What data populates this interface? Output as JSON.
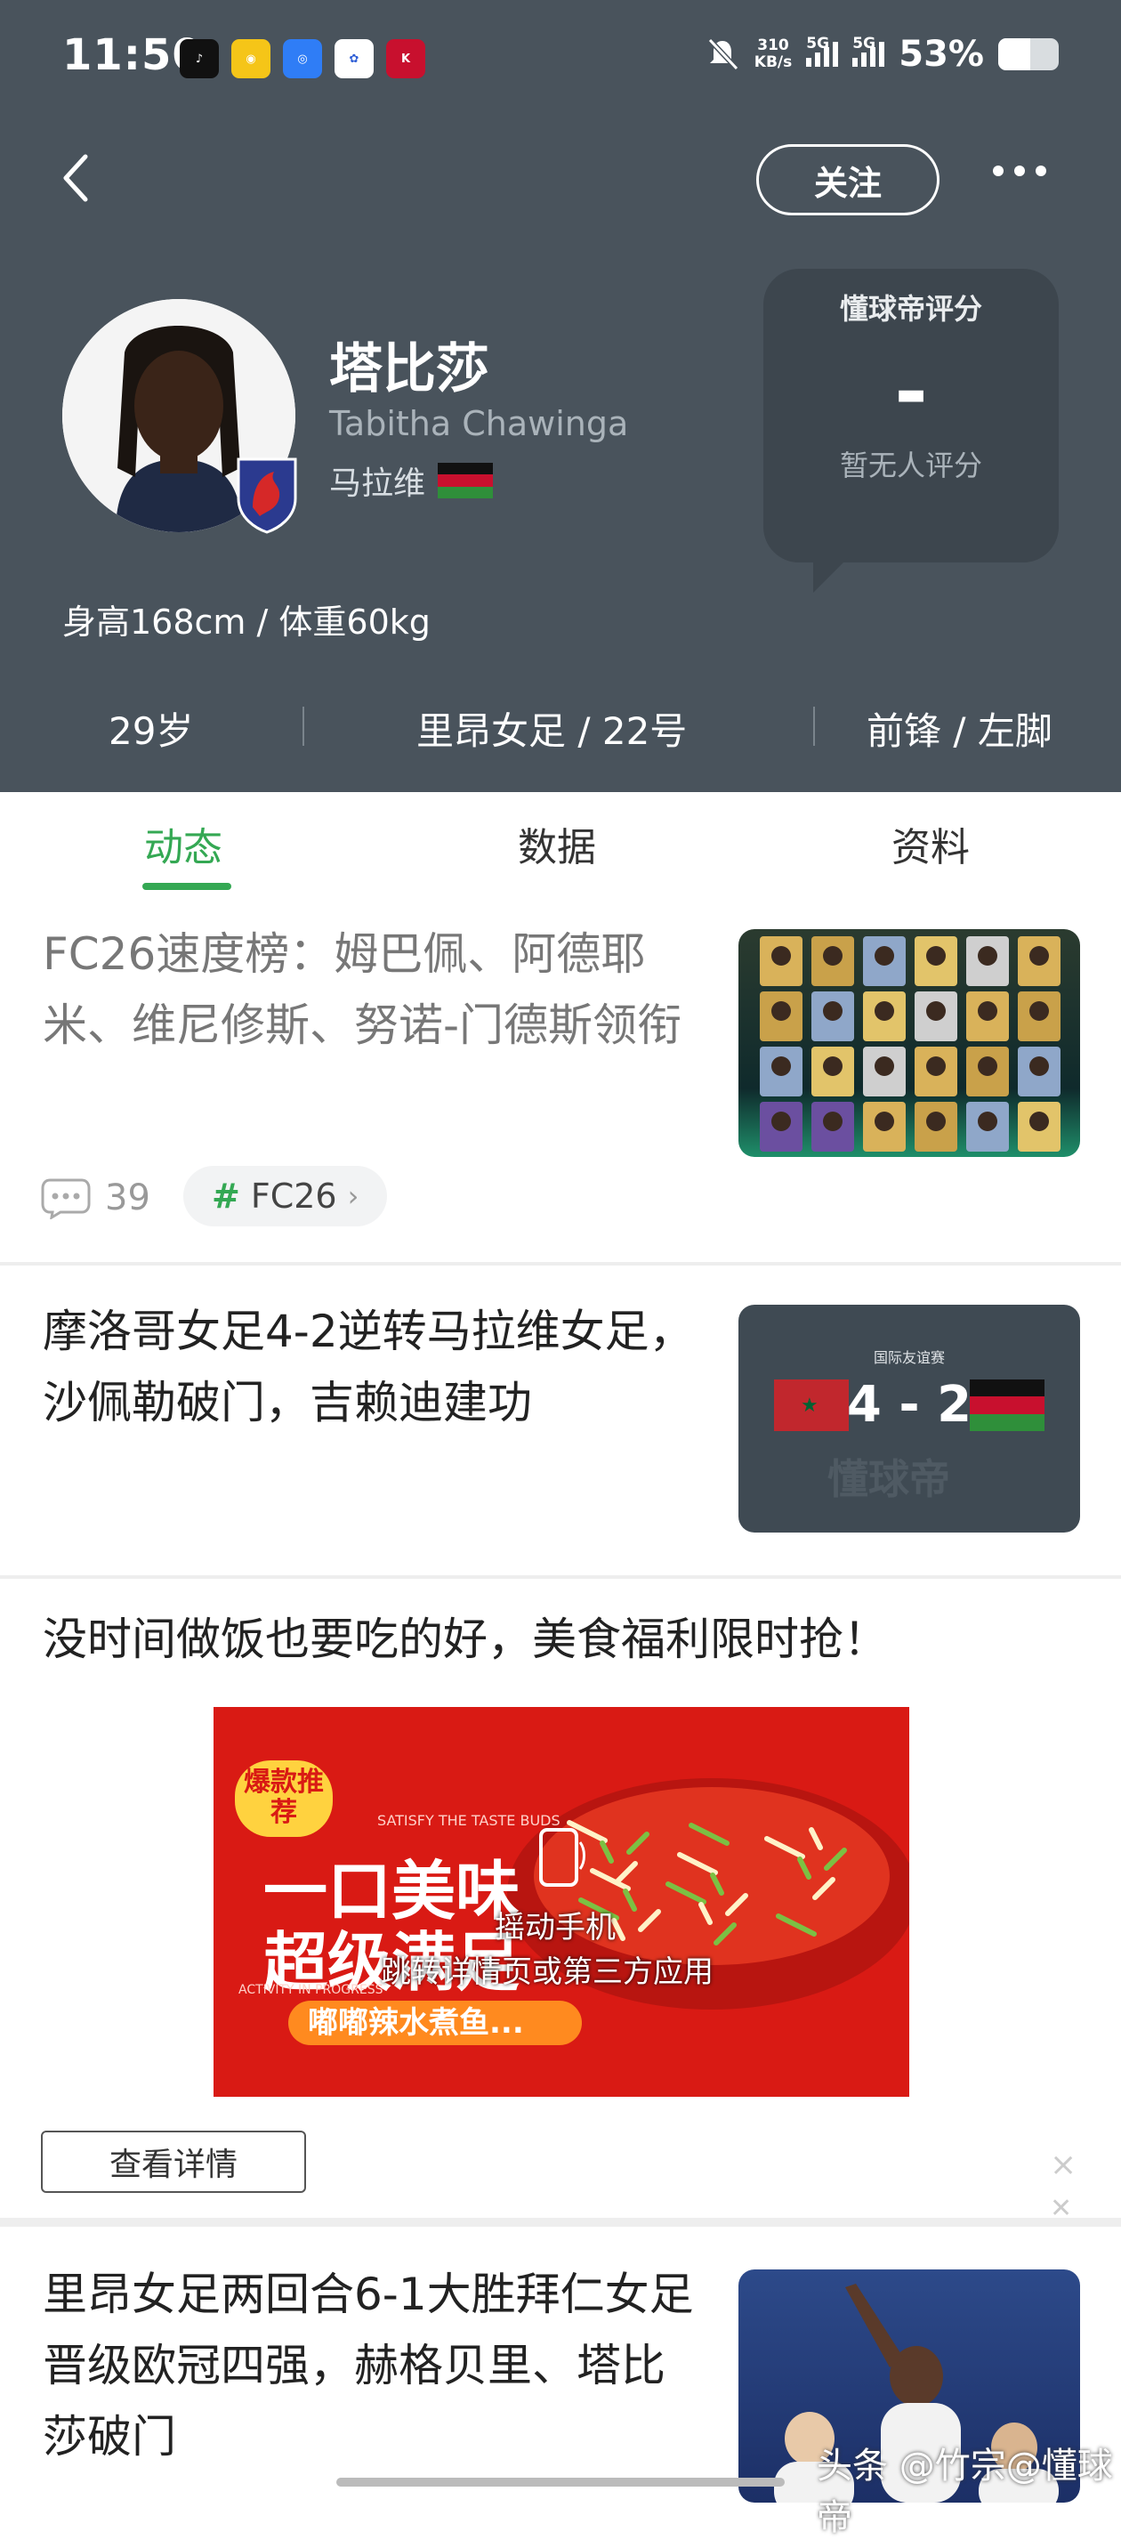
{
  "status_bar": {
    "time": "11:50",
    "net_speed_value": "310",
    "net_speed_unit": "KB/s",
    "signal1_label": "5G",
    "signal2_label": "5G",
    "battery_percent": "53%",
    "battery_level": 0.53
  },
  "header": {
    "follow_label": "关注",
    "more_icon": "more-dots-icon",
    "back_icon": "chevron-left-icon"
  },
  "player": {
    "name": "塔比莎",
    "english_name": "Tabitha Chawinga",
    "nationality": "马拉维",
    "height_weight": "身高168cm / 体重60kg",
    "age": "29岁",
    "club_number": "里昂女足 / 22号",
    "position_foot": "前锋 / 左脚"
  },
  "rating": {
    "title": "懂球帝评分",
    "value": "-",
    "note": "暂无人评分"
  },
  "tabs": [
    {
      "label": "动态",
      "active": true
    },
    {
      "label": "数据",
      "active": false
    },
    {
      "label": "资料",
      "active": false
    }
  ],
  "feed": [
    {
      "title": "FC26速度榜：姆巴佩、阿德耶米、维尼修斯、努诺-门德斯领衔",
      "comments": "39",
      "tag": "FC26"
    },
    {
      "title": "摩洛哥女足4-2逆转马拉维女足，沙佩勒破门，吉赖迪建功",
      "thumb_caption": "国际友谊赛",
      "thumb_score": "4 - 2",
      "thumb_watermark": "懂球帝"
    },
    {
      "ad_title": "没时间做饭也要吃的好，美食福利限时抢！",
      "ad_badge": "爆款推荐",
      "ad_slogan_en": "SATISFY THE TASTE BUDS",
      "ad_line1": "一口美味",
      "ad_line2": "超级满足",
      "ad_activity": "ACTIVITY IN PROGRESS",
      "ad_product": "嘟嘟辣水煮鱼...",
      "ad_shake": "摇动手机",
      "ad_jump": "跳转详情页或第三方应用",
      "ad_button": "查看详情",
      "ad_close": "×"
    },
    {
      "title": "里昂女足两回合6-1大胜拜仁女足晋级欧冠四强，赫格贝里、塔比莎破门"
    }
  ],
  "watermark": "头条 @竹宗@懂球帝",
  "colors": {
    "header_bg": "#49535c",
    "accent_green": "#34a853",
    "ad_red": "#d91a14"
  }
}
